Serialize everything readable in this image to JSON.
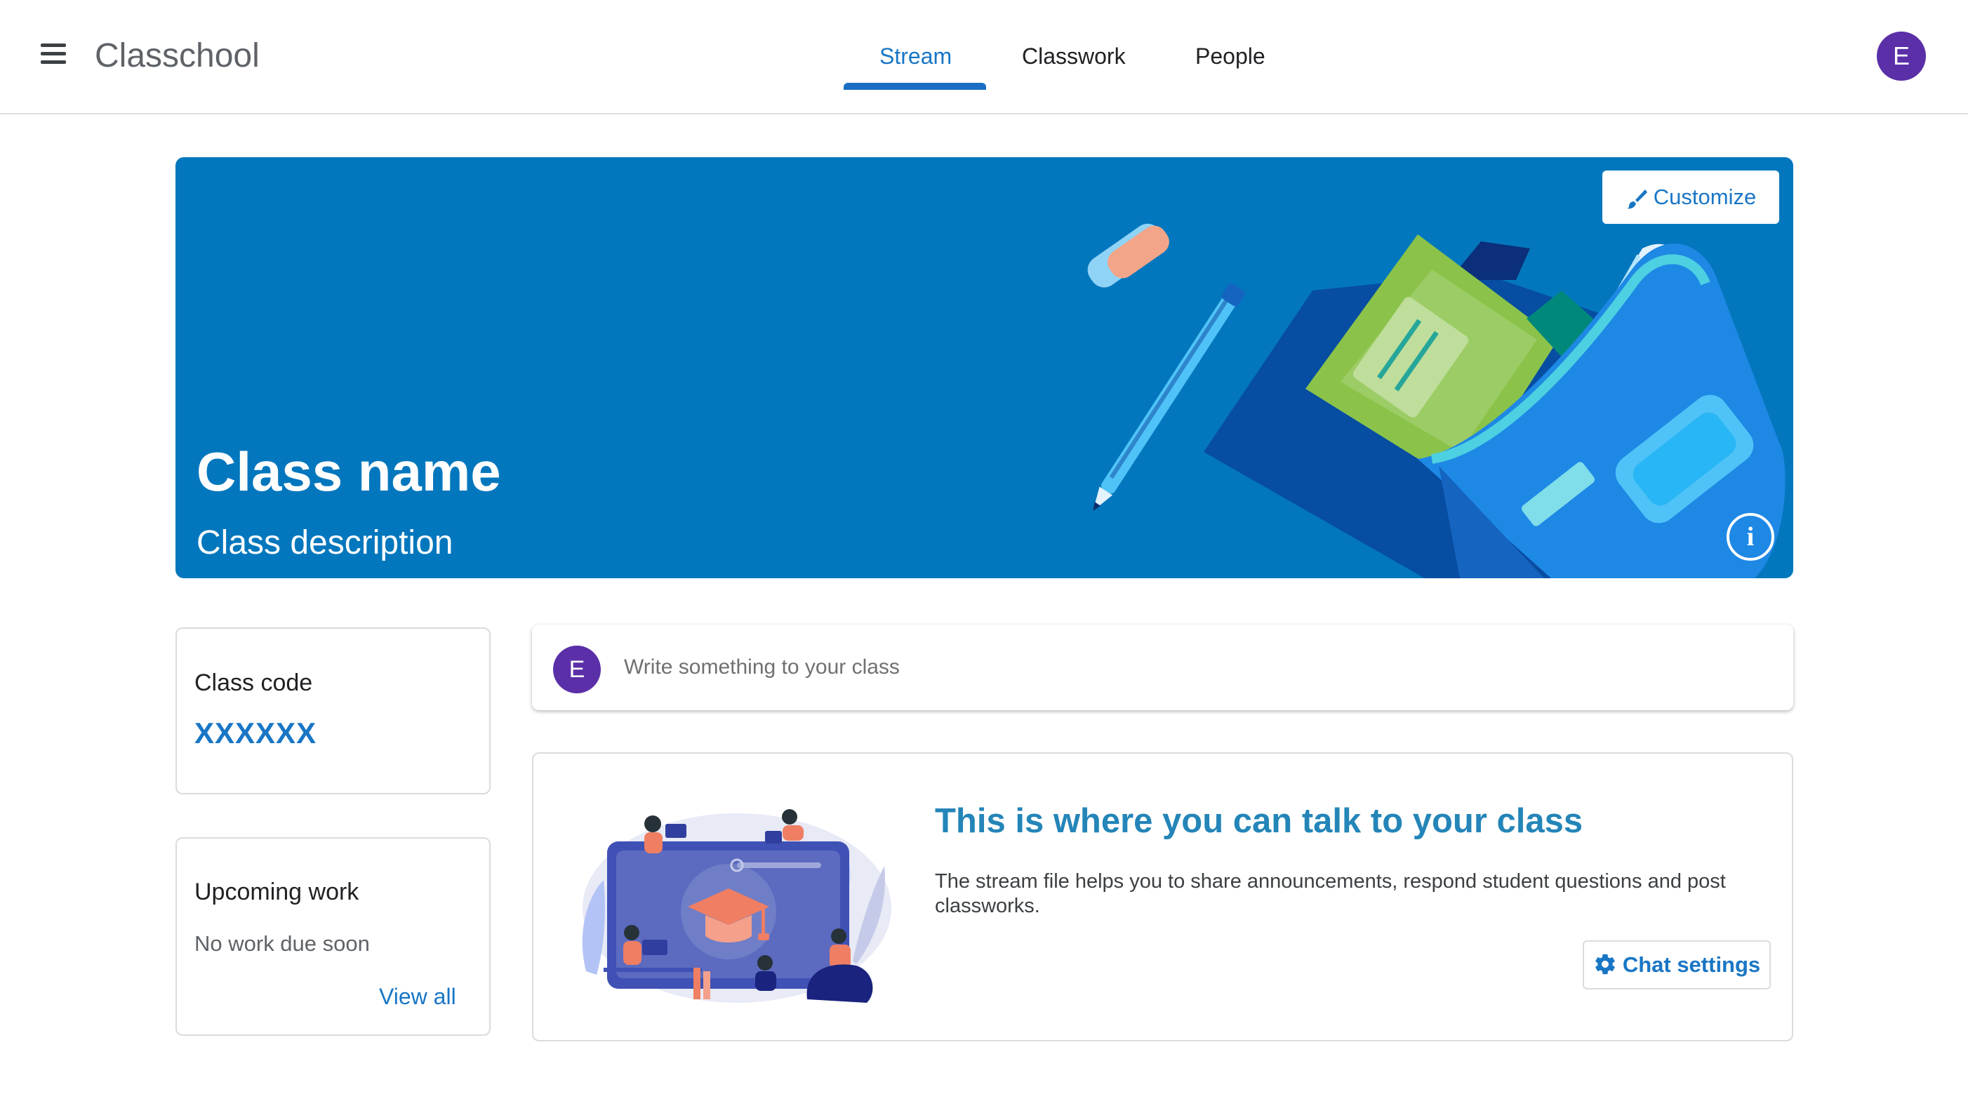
{
  "header": {
    "app_title": "Classchool",
    "menu_icon": "hamburger-menu-icon",
    "tabs": [
      {
        "label": "Stream",
        "active": true
      },
      {
        "label": "Classwork",
        "active": false
      },
      {
        "label": "People",
        "active": false
      }
    ],
    "avatar_initial": "E"
  },
  "banner": {
    "class_name": "Class name",
    "class_description": "Class description",
    "customize_label": "Customize",
    "customize_icon": "paintbrush-icon",
    "info_icon": "info-icon",
    "background_color": "#0377bd"
  },
  "sidebar": {
    "class_code_label": "Class code",
    "class_code_value": "XXXXXX",
    "upcoming_label": "Upcoming work",
    "upcoming_empty": "No work due soon",
    "view_all_label": "View all"
  },
  "compose": {
    "avatar_initial": "E",
    "placeholder": "Write something to your class"
  },
  "talk": {
    "title": "This is where you can talk to your class",
    "description": "The stream file helps you to share announcements, respond student questions and post classworks.",
    "chat_settings_label": "Chat settings",
    "chat_settings_icon": "gear-icon"
  },
  "colors": {
    "accent": "#1976c5",
    "avatar": "#5b2fa8",
    "title_teal": "#2485b8"
  }
}
